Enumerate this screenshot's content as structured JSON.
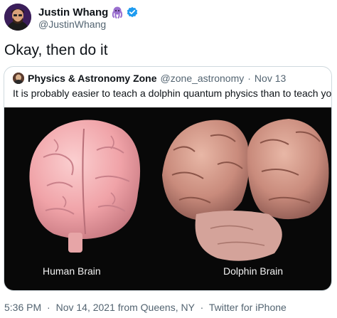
{
  "author": {
    "name": "Justin Whang",
    "handle": "@JustinWhang",
    "octopus_emoji": "🐙",
    "verified_color": "#1d9bf0"
  },
  "tweet": {
    "text": "Okay, then do it"
  },
  "quoted": {
    "name": "Physics & Astronomy Zone",
    "handle": "@zone_astronomy",
    "separator": "·",
    "date": "Nov 13",
    "text": "It is probably easier to teach a dolphin quantum physics than to teach you!",
    "image": {
      "left_caption": "Human Brain",
      "right_caption": "Dolphin Brain"
    }
  },
  "footer": {
    "time": "5:36 PM",
    "date": "Nov 14, 2021",
    "location": "from Queens, NY",
    "source": "Twitter for iPhone",
    "separator": "·"
  }
}
